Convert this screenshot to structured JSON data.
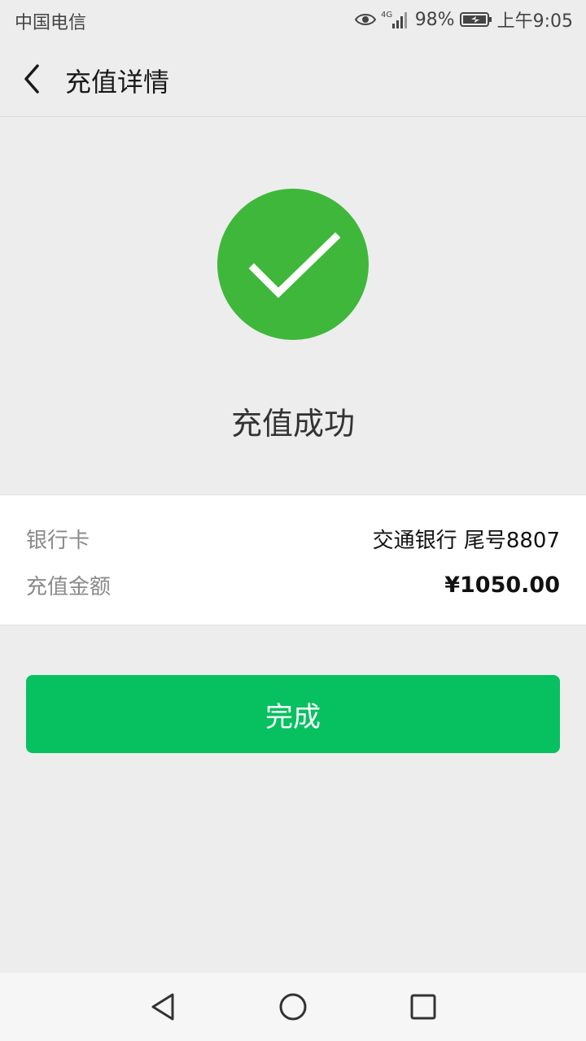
{
  "status_bar": {
    "carrier": "中国电信",
    "network": "4G",
    "battery": "98%",
    "time": "上午9:05"
  },
  "header": {
    "title": "充值详情"
  },
  "result": {
    "message": "充值成功",
    "accent_color": "#3fb73b"
  },
  "details": {
    "rows": [
      {
        "label": "银行卡",
        "value": "交通银行 尾号8807"
      },
      {
        "label": "充值金额",
        "value": "¥1050.00"
      }
    ]
  },
  "actions": {
    "done_label": "完成",
    "done_color": "#07c160"
  }
}
